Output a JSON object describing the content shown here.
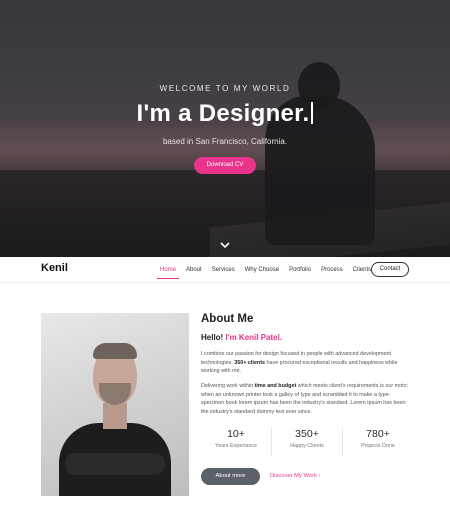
{
  "hero": {
    "eyebrow": "WELCOME TO MY WORLD",
    "headline": "I'm a Designer.",
    "subline": "based in San Francisco, California.",
    "cta_label": "Download CV",
    "accent_color": "#e8348a"
  },
  "nav": {
    "logo": "Kenil",
    "items": [
      {
        "label": "Home",
        "active": true
      },
      {
        "label": "About"
      },
      {
        "label": "Services"
      },
      {
        "label": "Why Choose"
      },
      {
        "label": "Portfolio"
      },
      {
        "label": "Process"
      },
      {
        "label": "Clients"
      }
    ],
    "contact_label": "Contact"
  },
  "about": {
    "title": "About Me",
    "hello_prefix": "Hello!",
    "hello_name": "I'm Kenil Patel.",
    "p1_a": "I combine our passion for design focused in people with advanced development technologies.",
    "p1_bold": "350+ clients",
    "p1_b": "have procured exceptional results and happiness while working with me.",
    "p2_a": "Delivering work within",
    "p2_bold": "time and budget",
    "p2_b": "which meets client's requirements is our moto; when an unknown printer took a galley of type and scrambled it to make a type-specimen book lorem ipsum has been the industry's standard. Lorem Ipsum has been the industry's standard dummy text ever since.",
    "stats": [
      {
        "value": "10+",
        "label": "Years Experiance"
      },
      {
        "value": "350+",
        "label": "Happy Clients"
      },
      {
        "value": "780+",
        "label": "Projects Done"
      }
    ],
    "about_button": "About more",
    "work_link": "Discover My Work",
    "work_arrow": "›"
  },
  "icons": {
    "scroll": "chevron-down-icon"
  }
}
